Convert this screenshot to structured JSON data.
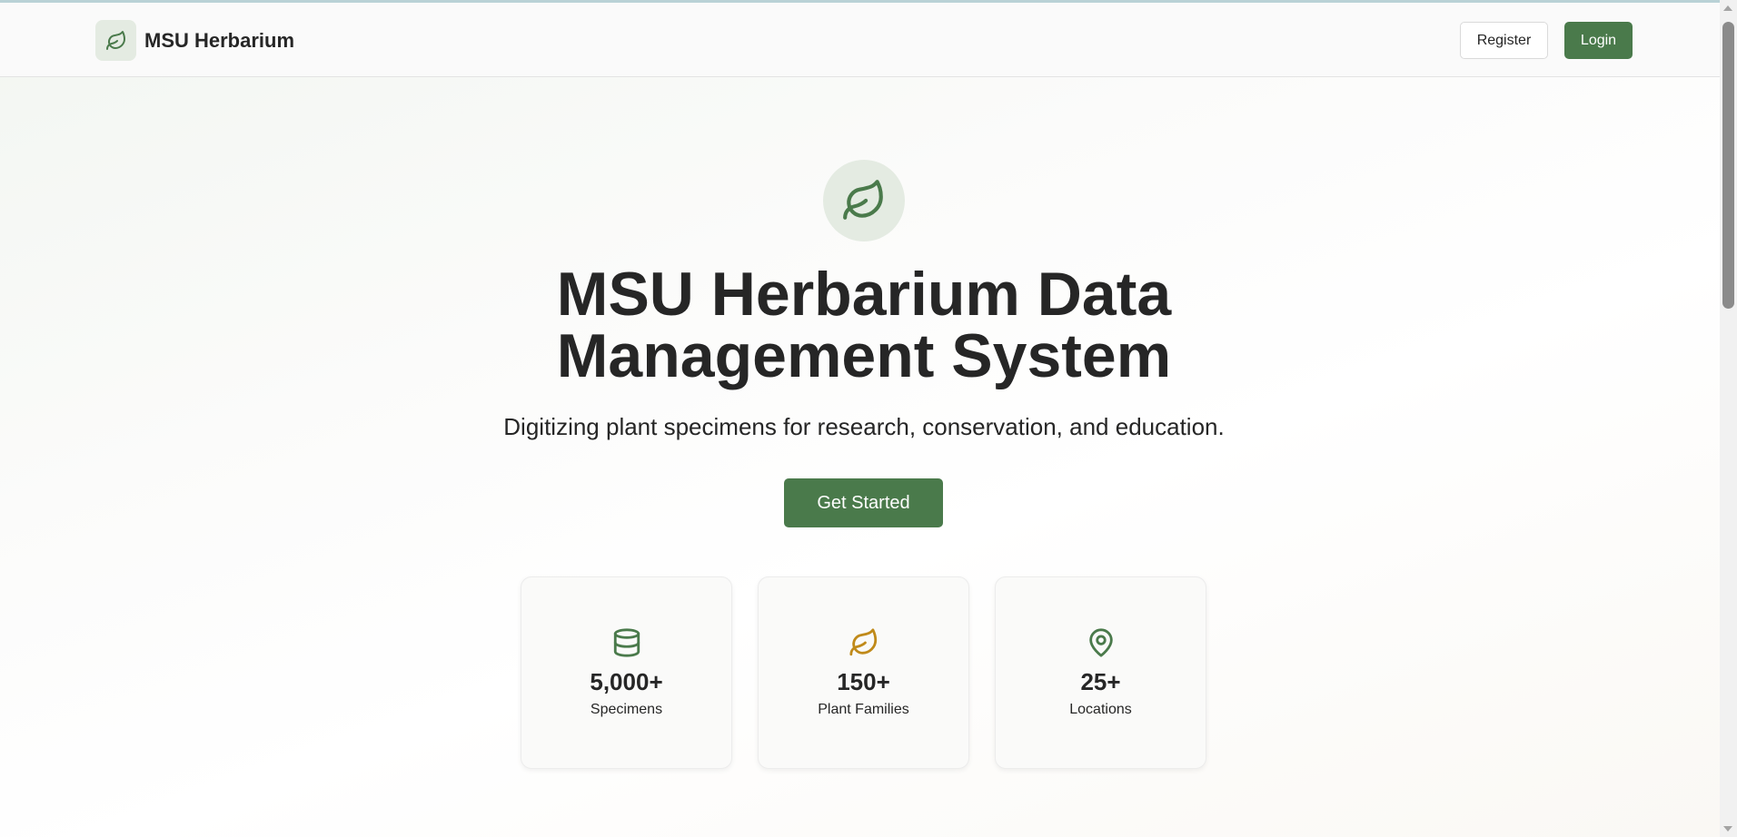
{
  "header": {
    "brand_name": "MSU Herbarium",
    "brand_icon": "leaf-icon",
    "register_label": "Register",
    "login_label": "Login"
  },
  "hero": {
    "icon": "leaf-icon",
    "title_line1": "MSU Herbarium Data",
    "title_line2": "Management System",
    "subtitle": "Digitizing plant specimens for research, conservation, and education.",
    "cta_label": "Get Started"
  },
  "stats": [
    {
      "icon": "database-icon",
      "value": "5,000+",
      "label": "Specimens",
      "icon_color": "#4a7a4b"
    },
    {
      "icon": "leaf-icon",
      "value": "150+",
      "label": "Plant Families",
      "icon_color": "#c08a1a"
    },
    {
      "icon": "map-pin-icon",
      "value": "25+",
      "label": "Locations",
      "icon_color": "#4a7a4b"
    }
  ],
  "colors": {
    "primary": "#4a7a4b",
    "accent": "#c08a1a",
    "icon_bg": "#e4ebe2",
    "text": "#262626"
  }
}
